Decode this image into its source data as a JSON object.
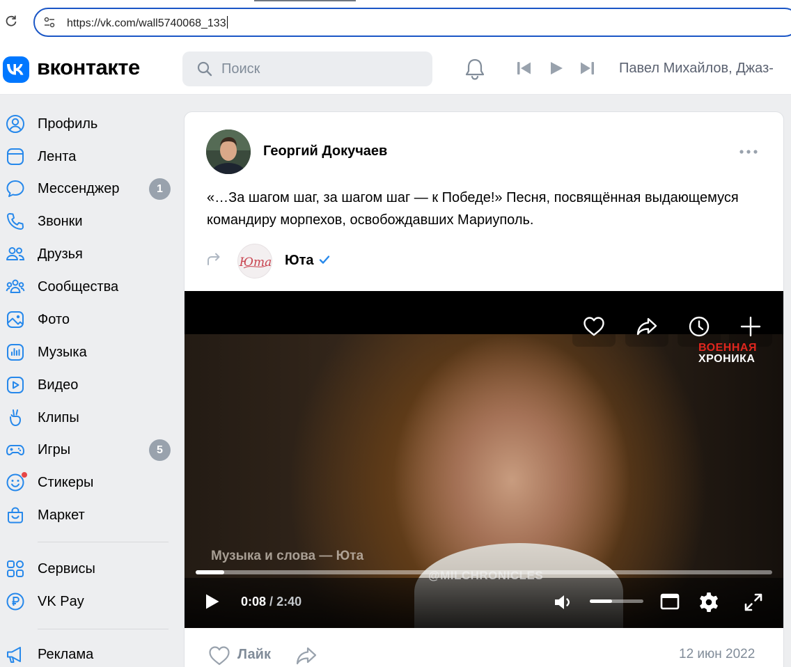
{
  "browser": {
    "url": "https://vk.com/wall5740068_133"
  },
  "header": {
    "brand": "вконтакте",
    "search_placeholder": "Поиск",
    "now_playing": "Павел Михайлов, Джаз-"
  },
  "sidebar": {
    "items": [
      {
        "label": "Профиль",
        "icon": "profile-icon"
      },
      {
        "label": "Лента",
        "icon": "feed-icon"
      },
      {
        "label": "Мессенджер",
        "icon": "messenger-icon",
        "badge": "1"
      },
      {
        "label": "Звонки",
        "icon": "phone-icon"
      },
      {
        "label": "Друзья",
        "icon": "friends-icon"
      },
      {
        "label": "Сообщества",
        "icon": "communities-icon"
      },
      {
        "label": "Фото",
        "icon": "photo-icon"
      },
      {
        "label": "Музыка",
        "icon": "music-icon"
      },
      {
        "label": "Видео",
        "icon": "video-icon"
      },
      {
        "label": "Клипы",
        "icon": "clips-icon"
      },
      {
        "label": "Игры",
        "icon": "games-icon",
        "badge": "5"
      },
      {
        "label": "Стикеры",
        "icon": "stickers-icon"
      },
      {
        "label": "Маркет",
        "icon": "market-icon"
      },
      {
        "label": "Сервисы",
        "icon": "services-icon"
      },
      {
        "label": "VK Pay",
        "icon": "vkpay-icon"
      },
      {
        "label": "Реклама",
        "icon": "ads-icon"
      }
    ]
  },
  "post": {
    "author": "Георгий Докучаев",
    "text": "«…За шагом шаг, за шагом шаг — к Победе!» Песня, посвящённая выдающемуся командиру морпехов, освобождавших Мариуполь.",
    "repost_source": "Юта",
    "repost_avatar_text": "Юта",
    "date": "12 июн 2022",
    "like_label": "Лайк"
  },
  "video": {
    "watermark_line1": "ВОЕННАЯ",
    "watermark_line2": "ХРОНИКА",
    "caption": "Музыка и слова — Юта",
    "handle": "@MILCHRONICLES",
    "current_time": "0:08",
    "separator": "/",
    "duration": "2:40",
    "progress": 0.05,
    "volume": 0.42
  },
  "colors": {
    "accent": "#0077ff",
    "badge": "#99a2ad",
    "icon_blue": "#2688eb",
    "muted_text": "#818c99"
  }
}
